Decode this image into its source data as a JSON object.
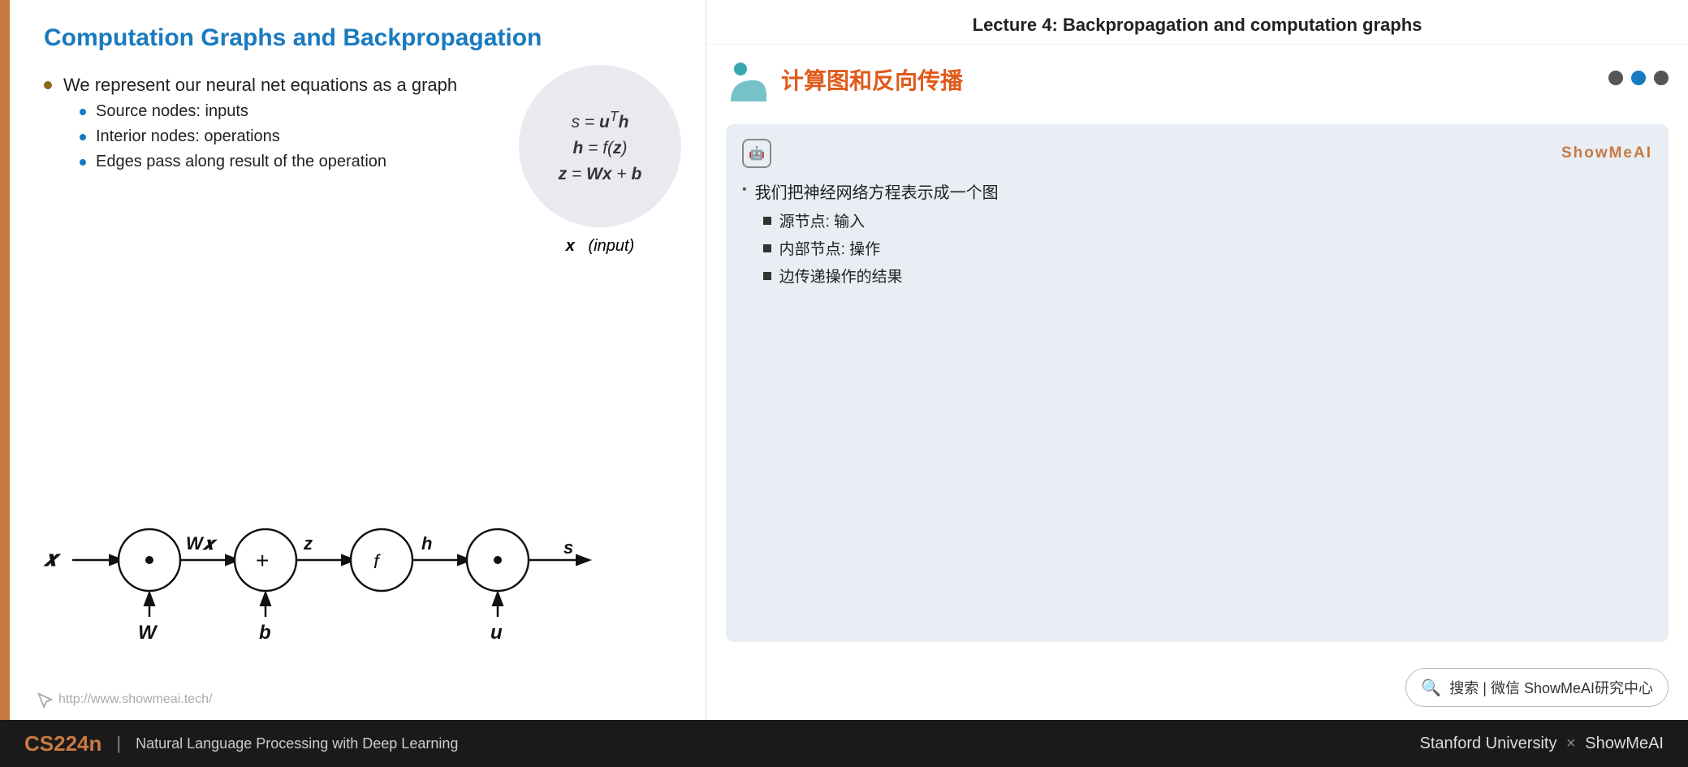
{
  "header": {
    "lecture_title": "Lecture 4:  Backpropagation and computation graphs"
  },
  "left_slide": {
    "title": "Computation Graphs and Backpropagation",
    "bullet1": "We represent our neural net equations as a graph",
    "sub1": "Source nodes: inputs",
    "sub2": "Interior nodes: operations",
    "sub3": "Edges pass along result of the operation",
    "equations": [
      "s = u^T h",
      "h = f(z)",
      "z = Wx + b",
      "x    (input)"
    ],
    "url": "http://www.showmeai.tech/"
  },
  "right_panel": {
    "chinese_title": "计算图和反向传播",
    "dots": [
      "inactive",
      "active",
      "inactive"
    ],
    "info_box": {
      "badge": "ShowMeAI",
      "bullet1": "我们把神经网络方程表示成一个图",
      "sub1": "源节点: 输入",
      "sub2": "内部节点: 操作",
      "sub3": "边传递操作的结果"
    },
    "search_bar": "搜索 | 微信 ShowMeAI研究中心"
  },
  "bottom_bar": {
    "course_code": "CS224n",
    "course_desc": "Natural Language Processing with Deep Learning",
    "right_text": "Stanford University × ShowMeAI"
  }
}
